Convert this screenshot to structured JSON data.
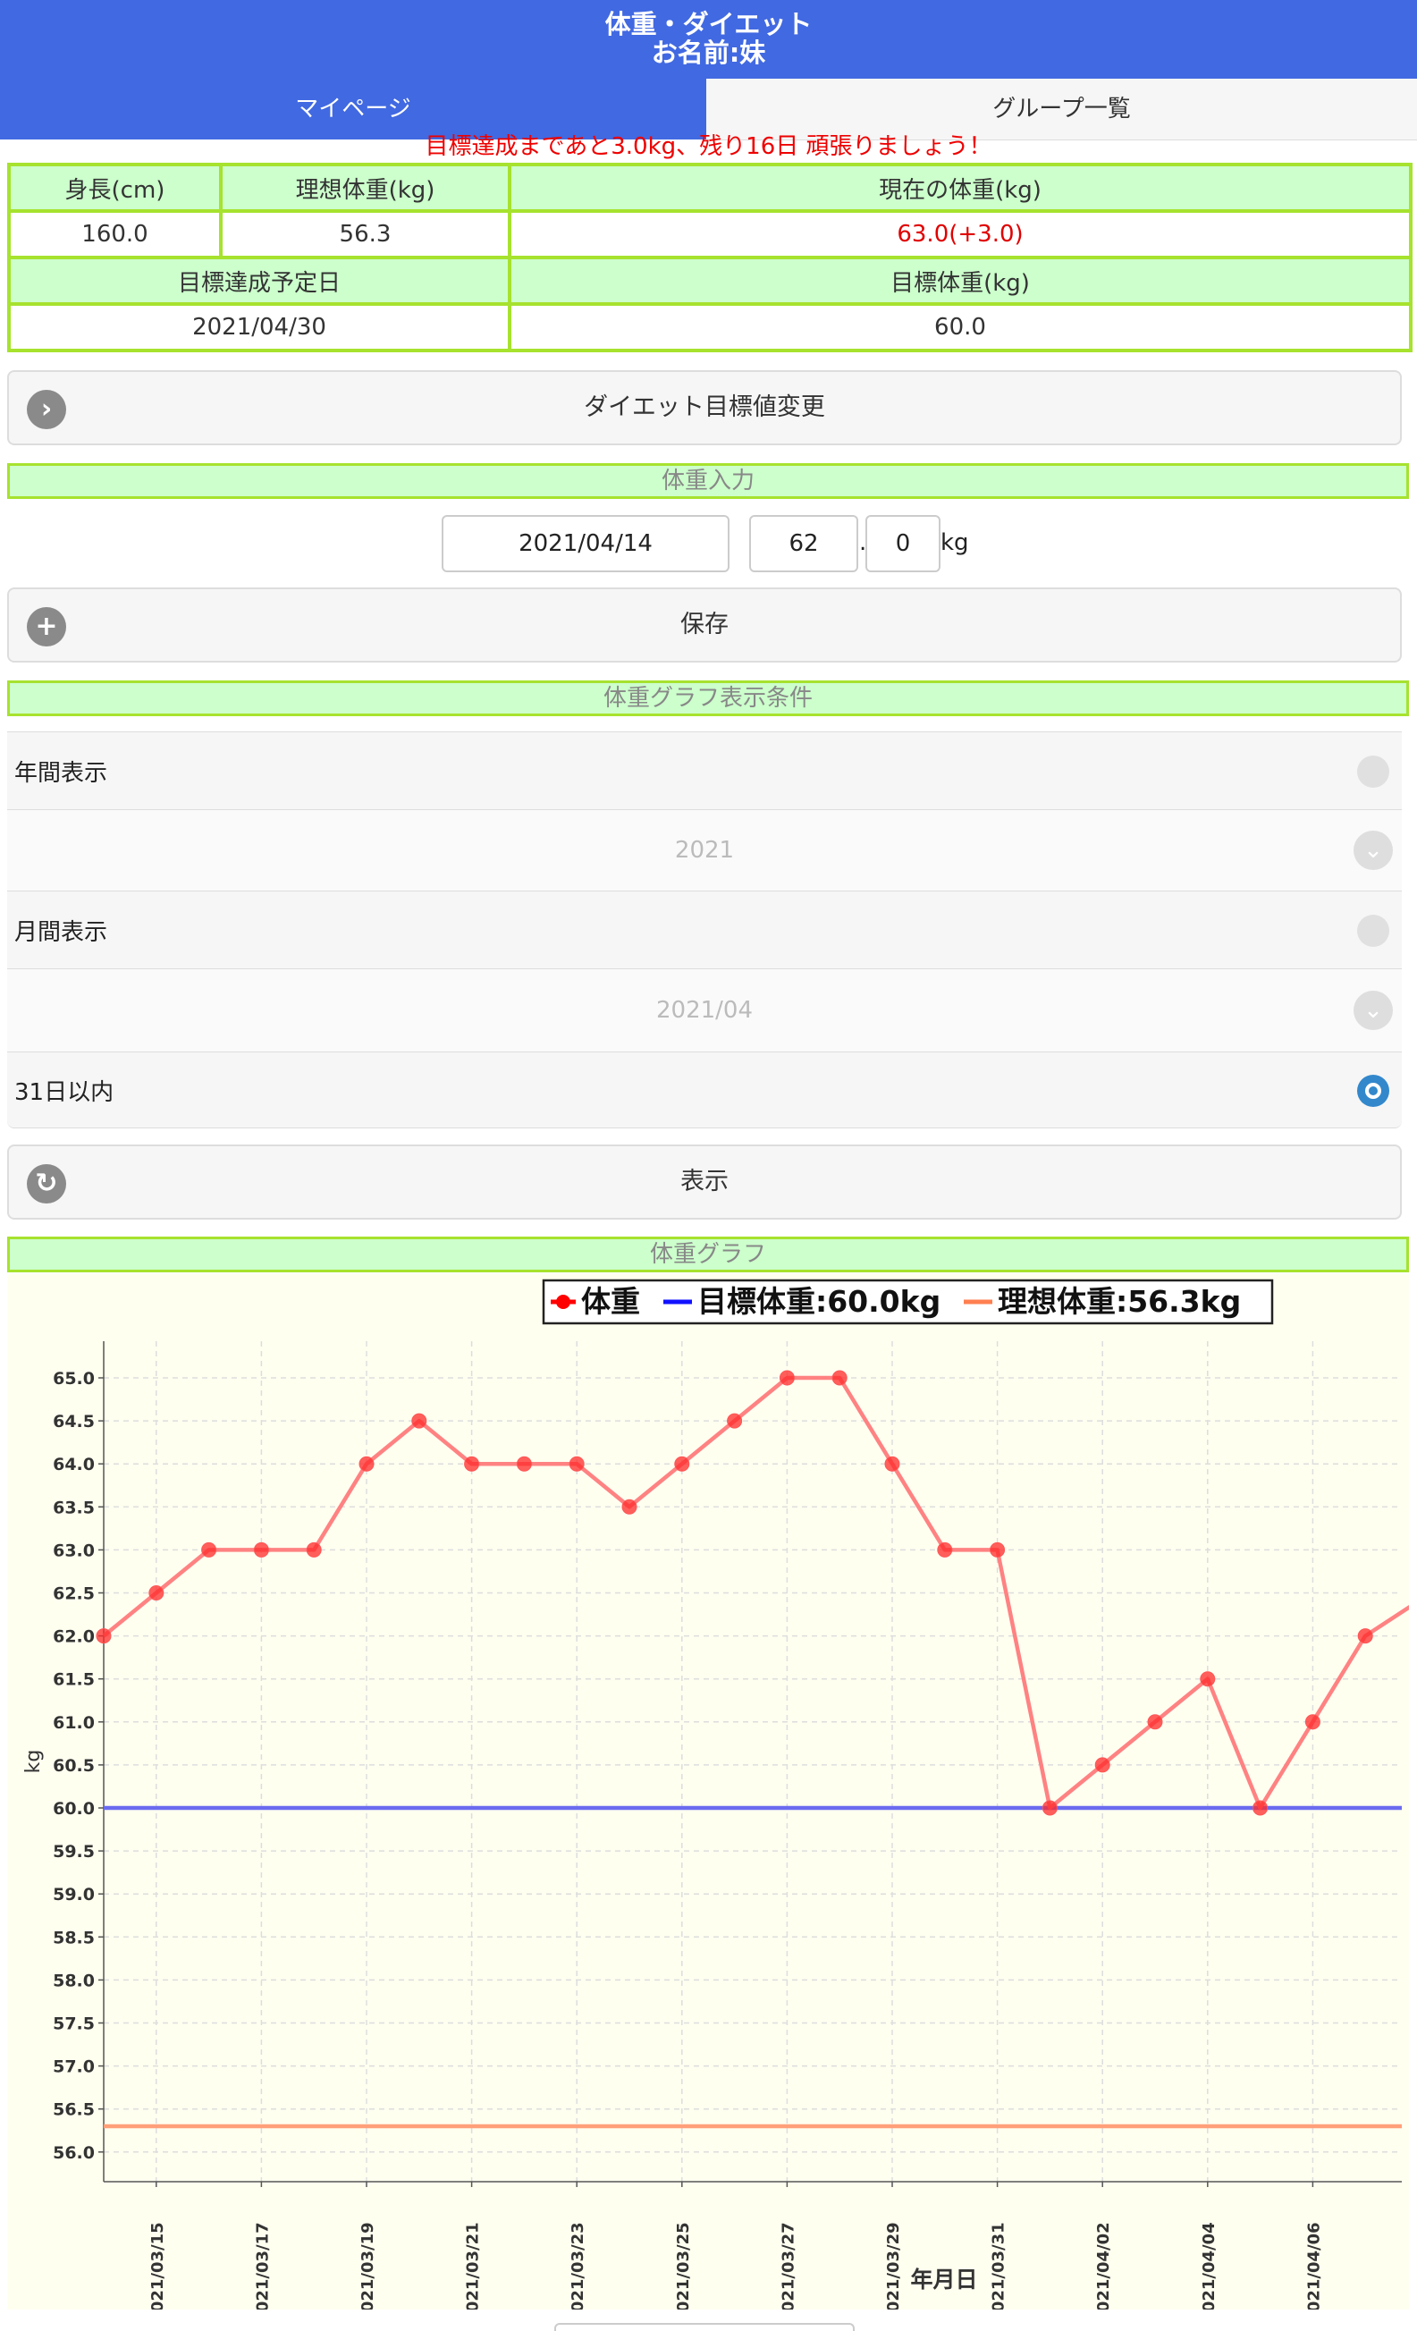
{
  "header": {
    "title": "体重・ダイエット",
    "subtitle": "お名前:妹"
  },
  "tabs": [
    {
      "label": "マイページ",
      "active": true
    },
    {
      "label": "グループ一覧",
      "active": false
    }
  ],
  "message": "目標達成まであと3.0kg、残り16日 頑張りましょう！",
  "info_table": {
    "height_label": "身長(cm)",
    "ideal_label": "理想体重(kg)",
    "current_label": "現在の体重(kg)",
    "height_value": "160.0",
    "ideal_value": "56.3",
    "current_value": "63.0(+3.0)",
    "target_date_label": "目標達成予定日",
    "target_weight_label": "目標体重(kg)",
    "target_date_value": "2021/04/30",
    "target_weight_value": "60.0"
  },
  "change_button": {
    "label": "ダイエット目標値変更",
    "icon": "chevron-right-icon"
  },
  "weight_input": {
    "section_title": "体重入力",
    "date": "2021/04/14",
    "integer": "62",
    "separator": ".",
    "decimal": "0",
    "unit": "kg"
  },
  "save_button": {
    "label": "保存",
    "icon": "plus-icon"
  },
  "graph_conditions": {
    "section_title": "体重グラフ表示条件",
    "yearly_label": "年間表示",
    "year_value": "2021",
    "monthly_label": "月間表示",
    "month_value": "2021/04",
    "recent_label": "31日以内",
    "selected": "31日以内"
  },
  "show_button": {
    "label": "表示",
    "icon": "refresh-icon"
  },
  "graph_section_title": "体重グラフ",
  "colors": {
    "header": "#4169e1",
    "section_bg": "#ccffcc",
    "section_border": "#a6e22e",
    "weight_line": "#ff7b7b",
    "target_line": "#6b6bf0",
    "ideal_line": "#ffa07a",
    "plot_bg": "#fffff0"
  },
  "chart_data": {
    "type": "line",
    "legend": [
      "体重",
      "目標体重:60.0kg",
      "理想体重:56.3kg"
    ],
    "xlabel": "年月日",
    "ylabel": "kg",
    "ylim": [
      56.0,
      65.0
    ],
    "yticks": [
      "56.0",
      "56.5",
      "57.0",
      "57.5",
      "58.0",
      "58.5",
      "59.0",
      "59.5",
      "60.0",
      "60.5",
      "61.0",
      "61.5",
      "62.0",
      "62.5",
      "63.0",
      "63.5",
      "64.0",
      "64.5",
      "65.0"
    ],
    "xticks": [
      "2021/03/15",
      "2021/03/17",
      "2021/03/19",
      "2021/03/21",
      "2021/03/23",
      "2021/03/25",
      "2021/03/27",
      "2021/03/29",
      "2021/03/31",
      "2021/04/02",
      "2021/04/04",
      "2021/04/06"
    ],
    "grid": true,
    "series": [
      {
        "name": "体重",
        "x": [
          "2021/03/14",
          "2021/03/15",
          "2021/03/16",
          "2021/03/17",
          "2021/03/18",
          "2021/03/19",
          "2021/03/20",
          "2021/03/21",
          "2021/03/22",
          "2021/03/23",
          "2021/03/24",
          "2021/03/25",
          "2021/03/26",
          "2021/03/27",
          "2021/03/28",
          "2021/03/29",
          "2021/03/30",
          "2021/03/31",
          "2021/04/01",
          "2021/04/02",
          "2021/04/03",
          "2021/04/04",
          "2021/04/05",
          "2021/04/06",
          "2021/04/07",
          "2021/04/08"
        ],
        "values": [
          62.0,
          62.5,
          63.0,
          63.0,
          63.0,
          64.0,
          64.5,
          64.0,
          64.0,
          64.0,
          63.5,
          64.0,
          64.5,
          65.0,
          65.0,
          64.0,
          63.0,
          63.0,
          60.0,
          60.5,
          61.0,
          61.5,
          60.0,
          61.0,
          62.0,
          62.4
        ]
      },
      {
        "name": "目標体重:60.0kg",
        "value": 60.0
      },
      {
        "name": "理想体重:56.3kg",
        "value": 56.3
      }
    ]
  }
}
